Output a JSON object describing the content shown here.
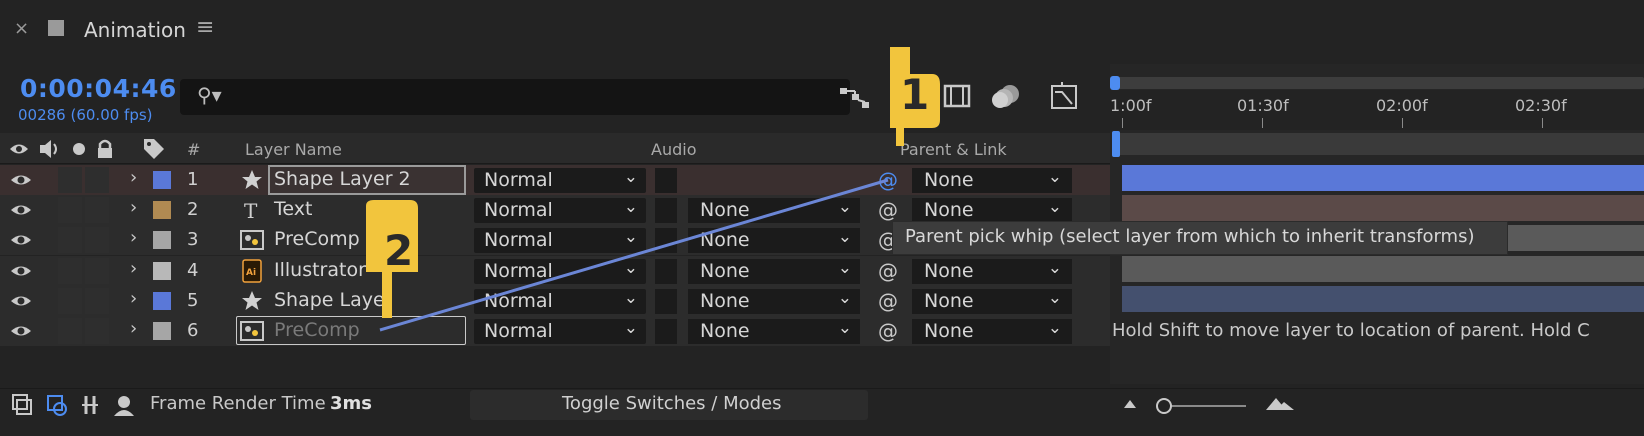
{
  "tab": {
    "title": "Animation",
    "close_icon": "close-icon",
    "menu_icon": "menu-icon"
  },
  "time": {
    "timecode": "0:00:04:46",
    "frames": "00286 (60.00 fps)"
  },
  "search": {
    "placeholder": ""
  },
  "columns": {
    "number": "#",
    "layer_name": "Layer Name",
    "audio": "Audio",
    "parent_link": "Parent & Link"
  },
  "layers": [
    {
      "num": "1",
      "name": "Shape Layer 2",
      "type_icon": "star-icon",
      "label_color": "#5a78d8",
      "mode": "Normal",
      "track": "",
      "parent": "None"
    },
    {
      "num": "2",
      "name": "Text",
      "type_icon": "text-icon",
      "label_color": "#b08a52",
      "mode": "Normal",
      "track": "None",
      "parent": "None"
    },
    {
      "num": "3",
      "name": "PreComp",
      "type_icon": "precomp-icon",
      "label_color": "#a6a6a6",
      "mode": "Normal",
      "track": "None",
      "parent": "None"
    },
    {
      "num": "4",
      "name": "Illustrator",
      "type_icon": "illustrator-icon",
      "label_color": "#b8b8b8",
      "mode": "Normal",
      "track": "None",
      "parent": "None"
    },
    {
      "num": "5",
      "name": "Shape Laye",
      "type_icon": "star-icon",
      "label_color": "#5a78d8",
      "mode": "Normal",
      "track": "None",
      "parent": "None"
    },
    {
      "num": "6",
      "name": "PreComp",
      "type_icon": "precomp-icon",
      "label_color": "#a6a6a6",
      "mode": "Normal",
      "track": "None",
      "parent": "None"
    }
  ],
  "timeline": {
    "ticks": [
      "1:00f",
      "01:30f",
      "02:00f",
      "02:30f"
    ]
  },
  "tooltip": "Parent pick whip (select layer from which to inherit transforms)",
  "hint": "Hold Shift to move layer to location of parent. Hold C",
  "footer": {
    "render_label": "Frame Render Time",
    "render_value": "3ms",
    "toggle": "Toggle Switches / Modes"
  },
  "annotations": {
    "step1": "1",
    "step2": "2"
  },
  "colors": {
    "accent": "#4d8cf0",
    "annotation_yellow": "#f2c53d"
  }
}
